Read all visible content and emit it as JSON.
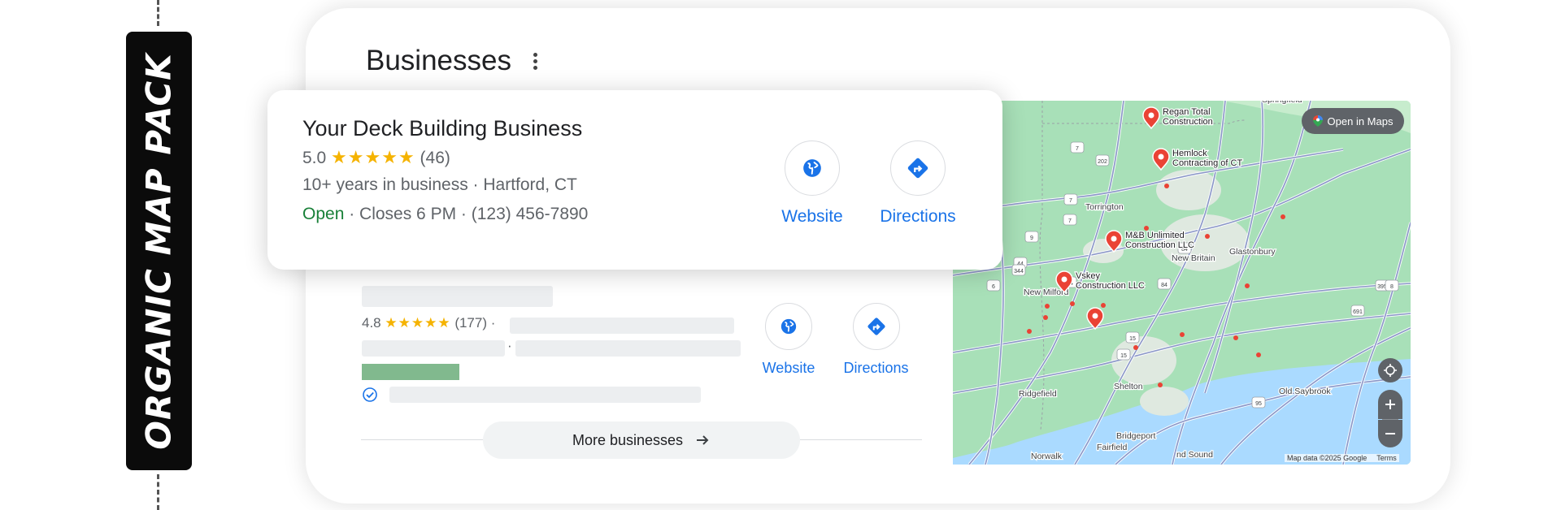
{
  "badge": {
    "text": "ORGANIC MAP PACK"
  },
  "panel": {
    "title": "Businesses"
  },
  "featured": {
    "name": "Your Deck Building Business",
    "rating": "5.0",
    "stars": "★★★★★",
    "reviews": "(46)",
    "info": "10+ years in business · Hartford, CT",
    "status": "Open",
    "closes": " · Closes 6 PM · ",
    "phone": "(123) 456-7890",
    "website_label": "Website",
    "directions_label": "Directions"
  },
  "second": {
    "rating": "4.8",
    "stars": "★★★★★",
    "reviews": "(177) ·",
    "sep": "·",
    "website_label": "Website",
    "directions_label": "Directions"
  },
  "more_businesses": "More businesses",
  "map": {
    "open_in_maps": "Open in Maps",
    "attribution": "Map data ©2025 Google",
    "terms": "Terms",
    "places": [
      {
        "name": "Springfield"
      },
      {
        "name": "Torrington"
      },
      {
        "name": "New Britain"
      },
      {
        "name": "Glastonbury"
      },
      {
        "name": "New Milford"
      },
      {
        "name": "Ridgefield"
      },
      {
        "name": "Shelton"
      },
      {
        "name": "Bridgeport"
      },
      {
        "name": "Fairfield"
      },
      {
        "name": "Norwalk"
      },
      {
        "name": "Old Saybrook"
      },
      {
        "name": "nd Sound"
      }
    ],
    "pins": [
      {
        "label1": "Regan Total",
        "label2": "Construction"
      },
      {
        "label1": "Hemlock",
        "label2": "Contracting of CT"
      },
      {
        "label1": "M&B Unlimited",
        "label2": "Construction LLC"
      },
      {
        "label1": "Vskey",
        "label2": "Construction LLC"
      },
      {
        "label1": "",
        "label2": ""
      }
    ],
    "shields": [
      "7",
      "202",
      "44",
      "344",
      "7",
      "9",
      "84",
      "84",
      "84",
      "691",
      "15",
      "95",
      "395",
      "7",
      "6",
      "15",
      "8"
    ]
  },
  "colors": {
    "accent": "#1a73e8",
    "open": "#188038",
    "star": "#f5b300",
    "pin": "#ea4335",
    "water": "#aadaff",
    "land": "#a8e0b8"
  }
}
